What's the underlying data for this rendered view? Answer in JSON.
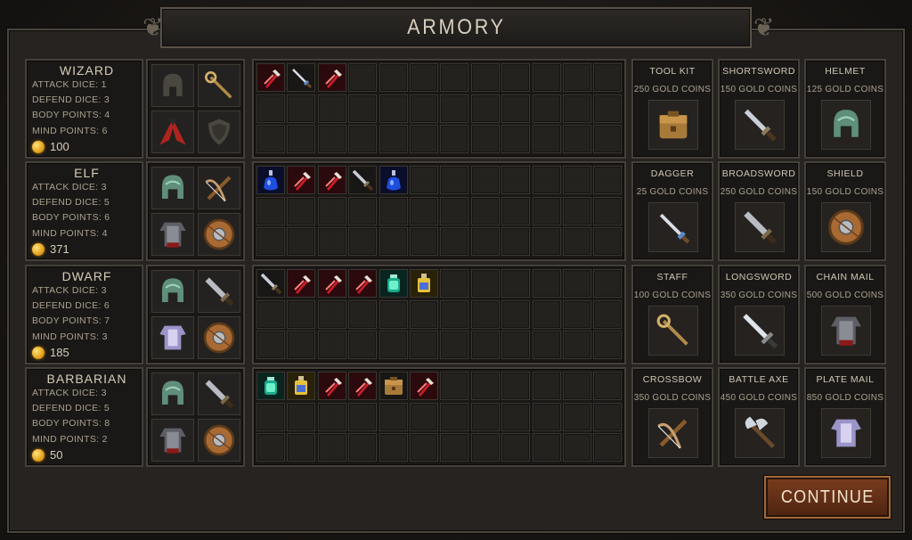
{
  "title": "ARMORY",
  "colors": {
    "accent": "#a06a3a",
    "gold": "#e3a21a",
    "panel": "#1a1816",
    "border": "#45403a"
  },
  "heroes": [
    {
      "name": "WIZARD",
      "stats": [
        "ATTACK DICE: 1",
        "DEFEND DICE: 3",
        "BODY POINTS: 4",
        "MIND POINTS: 6"
      ],
      "gold": "100",
      "equipment": [
        "helmet-slot-empty-icon",
        "staff-icon",
        "cloak-icon",
        "shield-slot-empty-icon"
      ],
      "inventory": [
        "potion-red-icon",
        "dagger-icon",
        "potion-red-icon"
      ]
    },
    {
      "name": "ELF",
      "stats": [
        "ATTACK DICE: 3",
        "DEFEND DICE: 5",
        "BODY POINTS: 6",
        "MIND POINTS: 4"
      ],
      "gold": "371",
      "equipment": [
        "helmet-icon",
        "crossbow-icon",
        "chain-mail-icon",
        "round-shield-icon"
      ],
      "inventory": [
        "potion-blue-icon",
        "potion-red-icon",
        "potion-red-icon",
        "shortsword-icon",
        "potion-blue-icon"
      ]
    },
    {
      "name": "DWARF",
      "stats": [
        "ATTACK DICE: 3",
        "DEFEND DICE: 6",
        "BODY POINTS: 7",
        "MIND POINTS: 3"
      ],
      "gold": "185",
      "equipment": [
        "helmet-icon",
        "broadsword-icon",
        "plate-armor-icon",
        "round-shield-icon"
      ],
      "inventory": [
        "shortsword-icon",
        "potion-red-icon",
        "potion-red-icon",
        "potion-red-icon",
        "potion-green-icon",
        "potion-yellow-icon"
      ]
    },
    {
      "name": "BARBARIAN",
      "stats": [
        "ATTACK DICE: 3",
        "DEFEND DICE: 5",
        "BODY POINTS: 8",
        "MIND POINTS: 2"
      ],
      "gold": "50",
      "equipment": [
        "helmet-icon",
        "broadsword-icon",
        "chain-mail-icon",
        "round-shield-icon"
      ],
      "inventory": [
        "potion-green-icon",
        "potion-yellow-icon",
        "potion-red-icon",
        "potion-red-icon",
        "tool-kit-icon",
        "potion-red-icon"
      ]
    }
  ],
  "shop": [
    {
      "name": "TOOL KIT",
      "price": "250 GOLD COINS",
      "icon": "tool-kit-icon"
    },
    {
      "name": "SHORTSWORD",
      "price": "150 GOLD COINS",
      "icon": "shortsword-icon"
    },
    {
      "name": "HELMET",
      "price": "125 GOLD COINS",
      "icon": "helmet-icon"
    },
    {
      "name": "DAGGER",
      "price": "25 GOLD COINS",
      "icon": "dagger-icon"
    },
    {
      "name": "BROADSWORD",
      "price": "250 GOLD COINS",
      "icon": "broadsword-icon"
    },
    {
      "name": "SHIELD",
      "price": "150 GOLD COINS",
      "icon": "round-shield-icon"
    },
    {
      "name": "STAFF",
      "price": "100 GOLD COINS",
      "icon": "staff-icon"
    },
    {
      "name": "LONGSWORD",
      "price": "350 GOLD COINS",
      "icon": "longsword-icon"
    },
    {
      "name": "CHAIN MAIL",
      "price": "500 GOLD COINS",
      "icon": "chain-mail-icon"
    },
    {
      "name": "CROSSBOW",
      "price": "350 GOLD COINS",
      "icon": "crossbow-icon"
    },
    {
      "name": "BATTLE AXE",
      "price": "450 GOLD COINS",
      "icon": "battle-axe-icon"
    },
    {
      "name": "PLATE MAIL",
      "price": "850 GOLD COINS",
      "icon": "plate-armor-icon"
    }
  ],
  "continue_label": "CONTINUE"
}
